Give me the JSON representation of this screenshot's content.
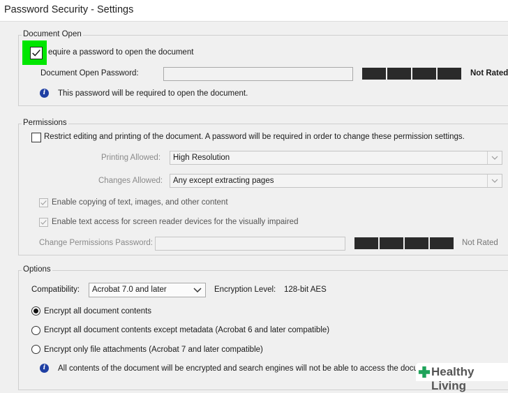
{
  "window": {
    "title": "Password Security - Settings"
  },
  "document_open": {
    "legend": "Document Open",
    "require_password_label": "equire a password to open the document",
    "require_password_checked": true,
    "password_label": "Document Open Password:",
    "password_value": "",
    "rating": "Not Rated",
    "info_text": "This password will be required to open the document."
  },
  "permissions": {
    "legend": "Permissions",
    "restrict_label": "Restrict editing and printing of the document. A password will be required in order to change these permission settings.",
    "restrict_checked": false,
    "printing_label": "Printing Allowed:",
    "printing_value": "High Resolution",
    "changes_label": "Changes Allowed:",
    "changes_value": "Any except extracting pages",
    "copy_label": "Enable copying of text, images, and other content",
    "copy_checked": true,
    "screen_reader_label": "Enable text access for screen reader devices for the visually impaired",
    "screen_reader_checked": true,
    "change_password_label": "Change Permissions Password:",
    "change_password_value": "",
    "rating": "Not Rated"
  },
  "options": {
    "legend": "Options",
    "compat_label": "Compatibility:",
    "compat_value": "Acrobat 7.0 and later",
    "encryption_label": "Encryption  Level:",
    "encryption_value": "128-bit AES",
    "radio_all": "Encrypt all document contents",
    "radio_except_metadata": "Encrypt all document contents except metadata (Acrobat 6 and later compatible)",
    "radio_attachments": "Encrypt only file attachments (Acrobat 7 and later compatible)",
    "selected": "radio_all",
    "info_text": "All contents of the document will be encrypted and search engines will not be able to access the docum"
  },
  "watermark": {
    "text": "Healthy Living"
  },
  "colors": {
    "highlight": "#00e600",
    "info_icon": "#1f3fa3",
    "meter": "#2a2a2a",
    "watermark_cross": "#1fa35a"
  }
}
